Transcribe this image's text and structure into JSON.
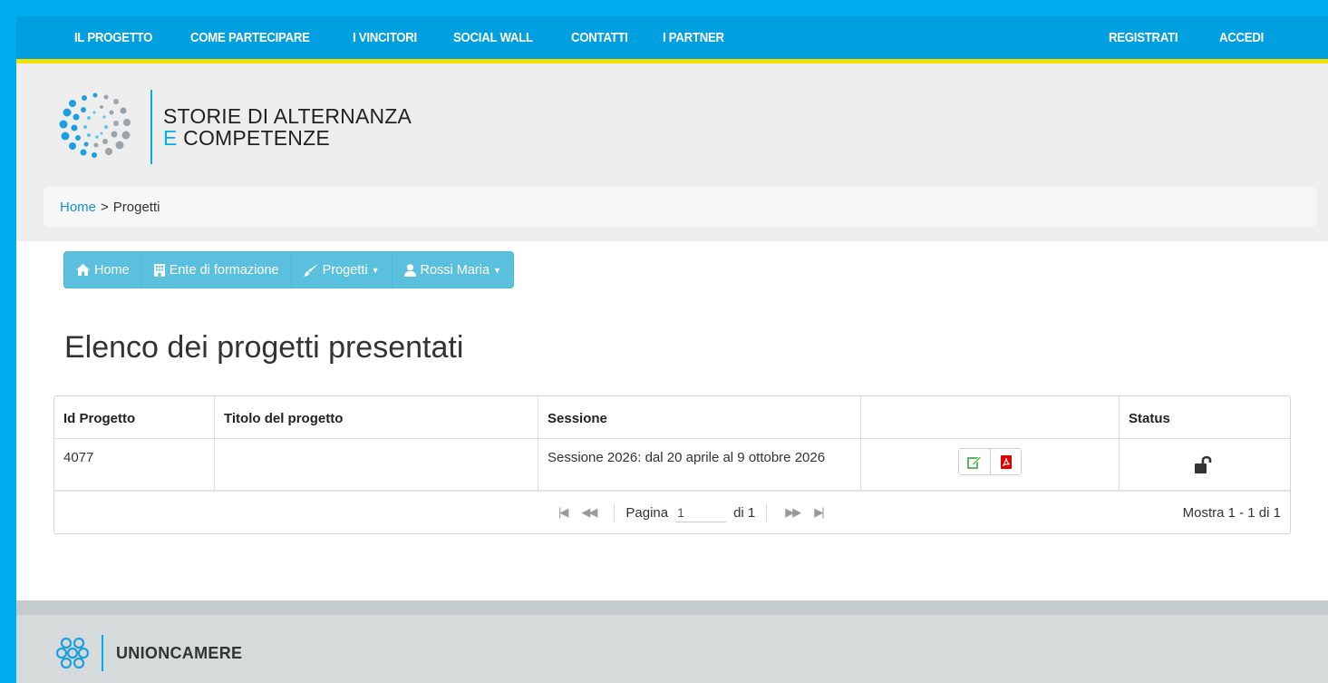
{
  "topnav": {
    "left_items": [
      "IL PROGETTO",
      "COME PARTECIPARE",
      "I VINCITORI",
      "SOCIAL WALL",
      "CONTATTI",
      "I PARTNER"
    ],
    "right_items": [
      "REGISTRATI",
      "ACCEDI"
    ]
  },
  "brand": {
    "line1": "STORIE DI ALTERNANZA",
    "line2_prefix": "E",
    "line2_rest": " COMPETENZE"
  },
  "breadcrumb": {
    "home": "Home",
    "sep": ">",
    "current": "Progetti"
  },
  "subnav": {
    "home": "Home",
    "ente": "Ente di formazione",
    "progetti": "Progetti",
    "user": "Rossi Maria"
  },
  "page_title": "Elenco dei progetti presentati",
  "table": {
    "headers": [
      "Id Progetto",
      "Titolo del progetto",
      "Sessione",
      "",
      "Status"
    ],
    "rows": [
      {
        "id": "4077",
        "titolo": "",
        "sessione": "Sessione 2026: dal 20 aprile al 9 ottobre 2026"
      }
    ]
  },
  "pager": {
    "page_label": "Pagina",
    "page_value": "1",
    "of_label": "di 1",
    "summary": "Mostra 1 - 1 di 1"
  },
  "footer": {
    "name": "UNIONCAMERE"
  },
  "colors": {
    "frame": "#00aeef",
    "nav": "#009fdf",
    "nav_underline": "#f5e100",
    "subnav": "#5bc0de",
    "edit_icon": "#5cb85c",
    "pdf_icon": "#e00000"
  },
  "icons": {
    "subnav": [
      "home-icon",
      "building-icon",
      "brush-icon",
      "user-icon"
    ],
    "actions": [
      "edit-icon",
      "pdf-icon"
    ],
    "status": "unlock-icon",
    "pager": [
      "first-page-icon",
      "prev-page-icon",
      "next-page-icon",
      "last-page-icon"
    ]
  }
}
